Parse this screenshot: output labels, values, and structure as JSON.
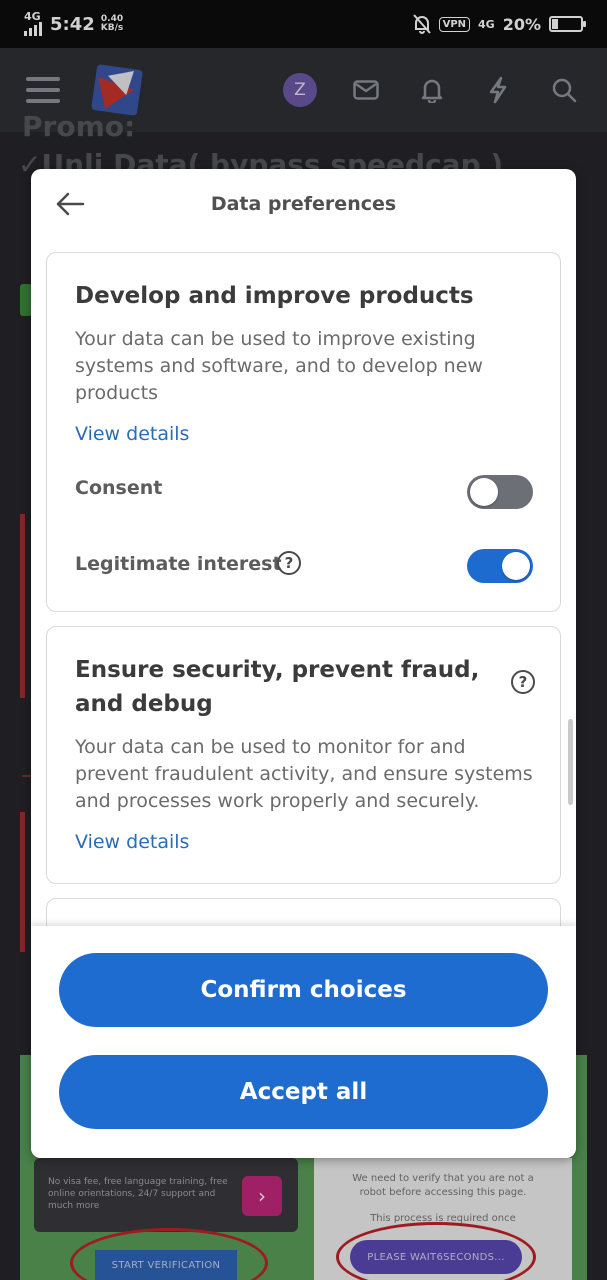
{
  "status_bar": {
    "network": "4G",
    "time": "5:42",
    "speed_value": "0.40",
    "speed_unit": "KB/s",
    "vpn": "VPN",
    "network_right": "4G",
    "battery": "20%"
  },
  "app_header": {
    "avatar_initial": "Z",
    "icons": [
      "menu-icon",
      "mail-icon",
      "bell-icon",
      "lightning-icon",
      "search-icon"
    ]
  },
  "background": {
    "line1": "Promo:",
    "line2": "✓Unli Data( bypass speedcap )",
    "banner_dark_text": "No visa fee, free language training, free online orientations, 24/7 support and much more",
    "banner_light_text": "We need to verify that you are not a robot before accessing this page.",
    "banner_light_text2": "This process is required once",
    "verify_button": "START VERIFICATION",
    "wait_button": "PLEASE WAIT6SECONDS..."
  },
  "dialog": {
    "title": "Data preferences",
    "cards": [
      {
        "title": "Develop and improve products",
        "description": "Your data can be used to improve existing systems and software, and to develop new products",
        "view_details": "View details",
        "consent_label": "Consent",
        "consent_on": false,
        "legitimate_label": "Legitimate interest",
        "legitimate_on": true
      },
      {
        "title": "Ensure security, prevent fraud, and debug",
        "description": "Your data can be used to monitor for and prevent fraudulent activity, and ensure systems and processes work properly and securely.",
        "view_details": "View details"
      }
    ],
    "confirm_button": "Confirm choices",
    "accept_button": "Accept all"
  },
  "colors": {
    "accent": "#1f6cd1",
    "link": "#2a6db5",
    "toggle_off": "#6c6f75"
  }
}
